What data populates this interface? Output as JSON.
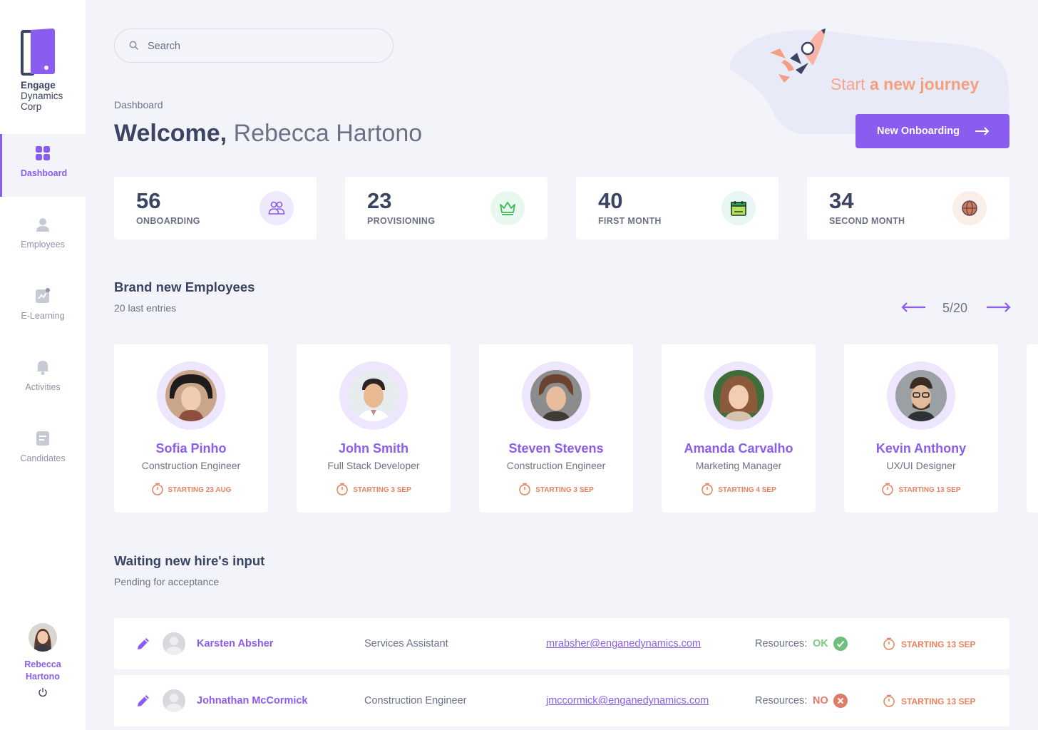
{
  "brand": {
    "line1": "Engage",
    "line2": "Dynamics",
    "line3": "Corp",
    "accent": "#8a5cf0"
  },
  "nav": [
    {
      "label": "Dashboard",
      "icon": "grid-icon",
      "active": true
    },
    {
      "label": "Employees",
      "icon": "person-icon",
      "active": false
    },
    {
      "label": "E-Learning",
      "icon": "chart-icon",
      "active": false
    },
    {
      "label": "Activities",
      "icon": "bell-icon",
      "active": false
    },
    {
      "label": "Candidates",
      "icon": "document-icon",
      "active": false
    }
  ],
  "user": {
    "name": "Rebecca Hartono"
  },
  "search": {
    "placeholder": "Search"
  },
  "header": {
    "breadcrumb": "Dashboard",
    "welcome": "Welcome,",
    "name": "Rebecca Hartono"
  },
  "promo": {
    "text_prefix": "Start",
    "text_emphasis": "a new journey",
    "button": "New Onboarding"
  },
  "stats": [
    {
      "value": "56",
      "label": "ONBOARDING",
      "icon": "people-icon",
      "color": "#8a5cf0",
      "bg": "#eeeafb"
    },
    {
      "value": "23",
      "label": "PROVISIONING",
      "icon": "crown-icon",
      "color": "#3fb65b",
      "bg": "#e9f8ee"
    },
    {
      "value": "40",
      "label": "FIRST MONTH",
      "icon": "calendar-icon",
      "color": "#2e9d4c",
      "bg": "#e8f7f3"
    },
    {
      "value": "34",
      "label": "SECOND MONTH",
      "icon": "globe-icon",
      "color": "#e8815f",
      "bg": "#fbeee9"
    }
  ],
  "new_employees": {
    "title": "Brand new Employees",
    "subtitle": "20 last entries",
    "pager": "5/20",
    "items": [
      {
        "name": "Sofia Pinho",
        "role": "Construction Engineer",
        "start": "STARTING 23 AUG"
      },
      {
        "name": "John Smith",
        "role": "Full Stack Developer",
        "start": "STARTING 3 SEP"
      },
      {
        "name": "Steven Stevens",
        "role": "Construction Engineer",
        "start": "STARTING 3 SEP"
      },
      {
        "name": "Amanda Carvalho",
        "role": "Marketing Manager",
        "start": "STARTING 4 SEP"
      },
      {
        "name": "Kevin Anthony",
        "role": "UX/UI Designer",
        "start": "STARTING 13 SEP"
      }
    ]
  },
  "waiting": {
    "title": "Waiting new hire's input",
    "subtitle": "Pending for acceptance",
    "rows": [
      {
        "name": "Karsten Absher",
        "role": "Services Assistant",
        "email": "mrabsher@enganedynamics.com",
        "resources_label": "Resources:",
        "resources": "OK",
        "start": "STARTING 13 SEP"
      },
      {
        "name": "Johnathan McCormick",
        "role": "Construction Engineer",
        "email": "jmccormick@enganedynamics.com",
        "resources_label": "Resources:",
        "resources": "NO",
        "start": "STARTING 13 SEP"
      }
    ]
  }
}
